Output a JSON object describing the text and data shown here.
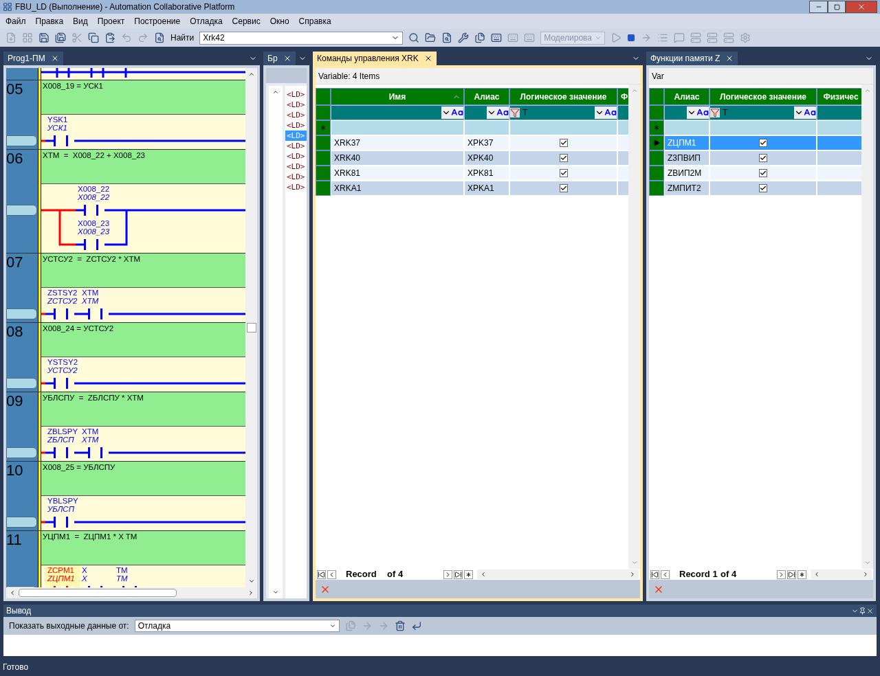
{
  "window": {
    "title": "FBU_LD (Выполнение) - Automation Collaborative Platform"
  },
  "menu": [
    {
      "label": "Файл"
    },
    {
      "label": "Правка"
    },
    {
      "label": "Вид"
    },
    {
      "label": "Проект"
    },
    {
      "label": "Построение"
    },
    {
      "label": "Отладка"
    },
    {
      "label": "Сервис"
    },
    {
      "label": "Окно"
    },
    {
      "label": "Справка"
    }
  ],
  "toolbar": {
    "find_label": "Найти",
    "find_value": "Xrk42",
    "mode": {
      "value": "Моделирова",
      "disabled": true
    }
  },
  "ladder_panel": {
    "tab": {
      "label": "Prog1-ПМ",
      "selected": false
    },
    "rungs": [
      {
        "number": "05",
        "expression": "X008_19 = УСК1",
        "kind": "series",
        "contacts": [
          {
            "label": "YSK1",
            "alias": "УСК1",
            "active": false
          }
        ]
      },
      {
        "number": "06",
        "expression": "XTM  =  X008_22 + X008_23",
        "kind": "parallel",
        "contacts": [
          {
            "label": "X008_22",
            "alias": "X008_22",
            "active": false
          },
          {
            "label": "X008_23",
            "alias": "X008_23",
            "active": false
          }
        ]
      },
      {
        "number": "07",
        "expression": "УСТСУ2  =  ZСТСУ2 * XTM",
        "kind": "series",
        "contacts": [
          {
            "label": "ZSTSY2",
            "alias": "ZСТСУ2",
            "active": false
          },
          {
            "label": "XTM",
            "alias": "XTM",
            "active": false
          }
        ]
      },
      {
        "number": "08",
        "expression": "X008_24 = УСТСУ2",
        "kind": "series",
        "contacts": [
          {
            "label": "YSTSY2",
            "alias": "УСТСУ2",
            "active": false
          }
        ]
      },
      {
        "number": "09",
        "expression": "УБЛСПУ  =  ZБЛСПУ * XTM",
        "kind": "series",
        "contacts": [
          {
            "label": "ZBLSPY",
            "alias": "ZБЛСП",
            "active": false
          },
          {
            "label": "XTM",
            "alias": "XTM",
            "active": false
          }
        ]
      },
      {
        "number": "10",
        "expression": "X008_25 = УБЛСПУ",
        "kind": "series",
        "contacts": [
          {
            "label": "YBLSPY",
            "alias": "УБЛСП",
            "active": false
          }
        ]
      },
      {
        "number": "11",
        "expression": "УЦПМ1  =  ZЦПМ1 * X TM",
        "kind": "series",
        "contacts": [
          {
            "label": "ZCPM1",
            "alias": "ZЦПМ1",
            "active": true
          },
          {
            "label": "X",
            "alias": "X",
            "active": false
          },
          {
            "label": "TM",
            "alias": "TM",
            "active": false
          }
        ]
      }
    ]
  },
  "browser_panel": {
    "tab": {
      "label": "Бр",
      "selected": false
    },
    "items": [
      {
        "label": "<LD>",
        "selected": false
      },
      {
        "label": "<LD>",
        "selected": false
      },
      {
        "label": "<LD>",
        "selected": false
      },
      {
        "label": "<LD>",
        "selected": false
      },
      {
        "label": "<LD>",
        "selected": true
      },
      {
        "label": "<LD>",
        "selected": false
      },
      {
        "label": "<LD>",
        "selected": false
      },
      {
        "label": "<LD>",
        "selected": false
      },
      {
        "label": "<LD>",
        "selected": false
      },
      {
        "label": "<LD>",
        "selected": false
      }
    ]
  },
  "xrk_panel": {
    "tab": {
      "label": "Команды управления XRK",
      "selected": true
    },
    "caption": "Variable: 4 Items",
    "columns": [
      {
        "label": "Имя",
        "kind": "name",
        "sorted": true
      },
      {
        "label": "Алиас",
        "kind": "alias",
        "sorted": false
      },
      {
        "label": "Логическое значение",
        "kind": "logic",
        "sorted": false,
        "filter": "T"
      },
      {
        "label": "Ф",
        "kind": "other",
        "sorted": false
      }
    ],
    "rows": [
      {
        "name": "XRK37",
        "alias": "XPK37",
        "checked": true,
        "selected": false
      },
      {
        "name": "XRK40",
        "alias": "XPK40",
        "checked": true,
        "selected": false
      },
      {
        "name": "XRK81",
        "alias": "XPK81",
        "checked": true,
        "selected": false
      },
      {
        "name": "XRKA1",
        "alias": "XPKA1",
        "checked": true,
        "selected": false
      }
    ],
    "nav": {
      "record": "Record",
      "count": "of 4"
    }
  },
  "z_panel": {
    "tab": {
      "label": "Функции памяти Z",
      "selected": false
    },
    "caption": "Var",
    "columns": [
      {
        "label": "Алиас",
        "kind": "alias",
        "sorted": false
      },
      {
        "label": "Логическое значение",
        "kind": "logic",
        "sorted": false,
        "filter": "T"
      },
      {
        "label": "Физичес",
        "kind": "other",
        "sorted": false
      }
    ],
    "rows": [
      {
        "alias": "ZЦПМ1",
        "checked": true,
        "selected": true
      },
      {
        "alias": "Z3ПВИП",
        "checked": true,
        "selected": false
      },
      {
        "alias": "ZВИП2М",
        "checked": true,
        "selected": false
      },
      {
        "alias": "ZМПИТ2",
        "checked": true,
        "selected": false
      }
    ],
    "nav": {
      "record": "Record 1",
      "count": "of 4"
    }
  },
  "output": {
    "title": "Вывод",
    "source_label": "Показать выходные данные от:",
    "source": "Отладка"
  },
  "status_bar": "Готово"
}
